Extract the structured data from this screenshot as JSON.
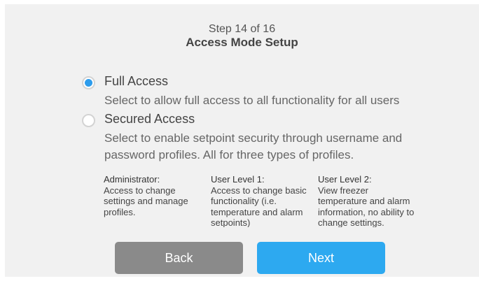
{
  "header": {
    "step": "Step 14 of 16",
    "title": "Access Mode Setup"
  },
  "options": [
    {
      "title": "Full Access",
      "description": "Select to allow full access to all functionality for all users",
      "selected": true
    },
    {
      "title": "Secured Access",
      "description": "Select to enable setpoint security through  username and password profiles. All for three types of profiles.",
      "selected": false
    }
  ],
  "levels": [
    {
      "title": "Administrator:",
      "description": "Access to change settings and manage profiles."
    },
    {
      "title": "User Level 1:",
      "description": "Access to change basic functionality (i.e. temperature and alarm setpoints)"
    },
    {
      "title": "User Level 2:",
      "description": "View freezer temperature and alarm information, no ability to change settings."
    }
  ],
  "buttons": {
    "back": "Back",
    "next": "Next"
  },
  "colors": {
    "accent": "#2da9f0",
    "radio_selected": "#2d9cec",
    "back_button": "#8a8a8a",
    "background": "#f1f1f1"
  }
}
